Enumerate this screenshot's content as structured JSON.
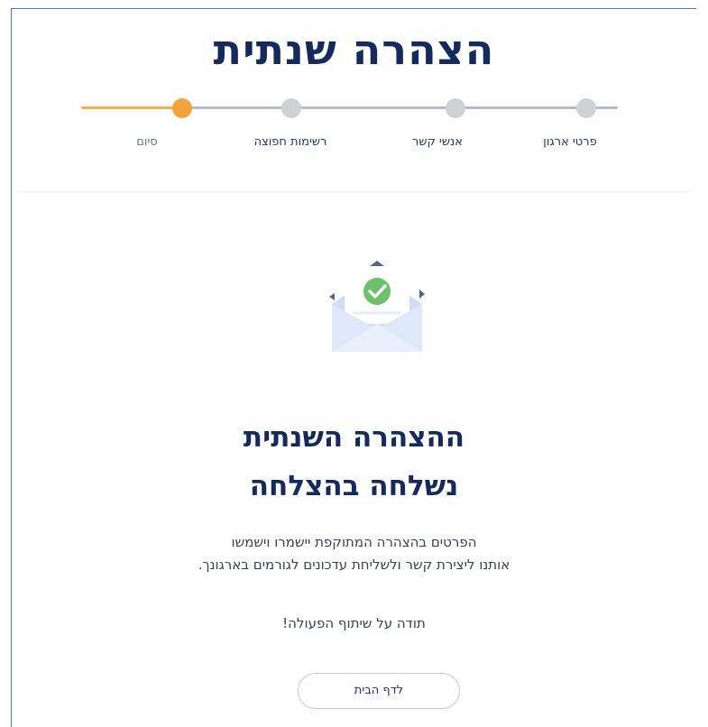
{
  "page": {
    "title": "הצהרה שנתית"
  },
  "stepper": {
    "steps": [
      {
        "label": "סיום",
        "state": "active"
      },
      {
        "label": "רשימות חפוצה",
        "state": "pending"
      },
      {
        "label": "אנשי קשר",
        "state": "pending"
      },
      {
        "label": "פרטי ארגון",
        "state": "pending"
      }
    ],
    "colors": {
      "active": "#f2a33a",
      "inactive": "#cfd1d5"
    }
  },
  "illustration": {
    "icon": "envelope-check-icon"
  },
  "message": {
    "headline_line1": "ההצהרה השנתית",
    "headline_line2": "נשלחה בהצלחה",
    "description_line1": "הפרטים בהצהרה המתוקפת יישמרו וישמשו",
    "description_line2": "אותנו ליצירת קשר ולשליחת עדכונים לגורמים בארגונך.",
    "thanks": "תודה על שיתוף הפעולה!"
  },
  "actions": {
    "home_label": "לדף הבית"
  }
}
